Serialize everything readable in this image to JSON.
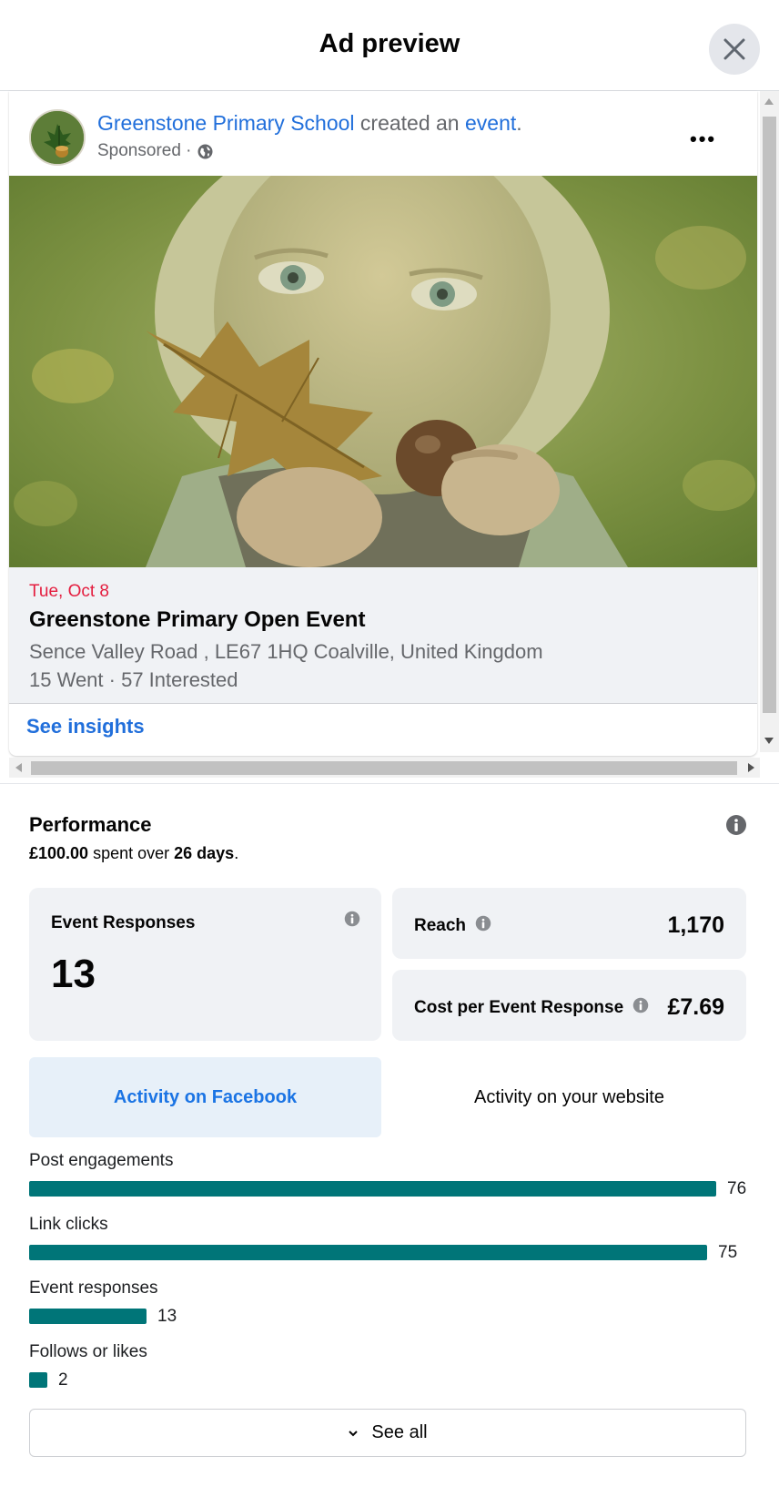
{
  "header": {
    "title": "Ad preview"
  },
  "post": {
    "page_name": "Greenstone Primary School",
    "action_text": " created an ",
    "object_link": "event",
    "period": ".",
    "sponsored": "Sponsored ·",
    "more": "•••"
  },
  "event": {
    "date": "Tue, Oct 8",
    "title": "Greenstone Primary Open Event",
    "location": "Sence Valley Road , LE67 1HQ Coalville, United Kingdom",
    "stats": "15 Went · 57 Interested"
  },
  "insights": {
    "link": "See insights"
  },
  "performance": {
    "title": "Performance",
    "spent_amount": "£100.00",
    "spent_text": " spent over ",
    "spent_days": "26 days",
    "spent_end": "."
  },
  "cards": {
    "event_responses_label": "Event Responses",
    "event_responses_value": "13",
    "reach_label": "Reach",
    "reach_value": "1,170",
    "cost_label": "Cost per Event Response",
    "cost_value": "£7.69"
  },
  "tabs": {
    "facebook": "Activity on Facebook",
    "website": "Activity on your website"
  },
  "metrics": [
    {
      "label": "Post engagements",
      "value": "76",
      "count": 76
    },
    {
      "label": "Link clicks",
      "value": "75",
      "count": 75
    },
    {
      "label": "Event responses",
      "value": "13",
      "count": 13
    },
    {
      "label": "Follows or likes",
      "value": "2",
      "count": 2
    }
  ],
  "see_all": {
    "label": "See all"
  },
  "colors": {
    "accent": "#216fdb",
    "bar": "#007578",
    "date": "#e41e3f"
  }
}
